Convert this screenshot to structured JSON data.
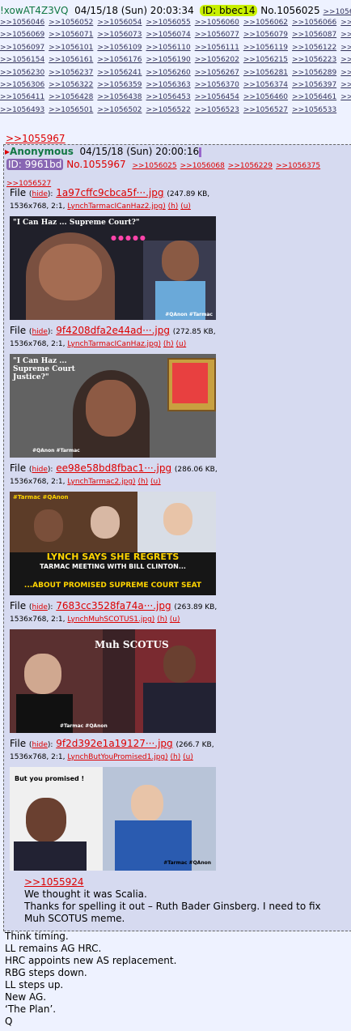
{
  "top_post": {
    "trip": "!xowAT4Z3VQ",
    "date": "04/15/18 (Sun) 20:03:34",
    "id": "ID: bbec14",
    "no": "No.1056025",
    "ref_partial": ">>105604"
  },
  "backlinks": [
    [
      ">>1056046",
      ">>1056052",
      ">>1056054",
      ">>1056055",
      ">>1056060",
      ">>1056062",
      ">>1056066",
      ">>10"
    ],
    [
      ">>1056069",
      ">>1056071",
      ">>1056073",
      ">>1056074",
      ">>1056077",
      ">>1056079",
      ">>1056087",
      ">>10"
    ],
    [
      ">>1056097",
      ">>1056101",
      ">>1056109",
      ">>1056110",
      ">>1056111",
      ">>1056119",
      ">>1056122",
      ">>10"
    ],
    [
      ">>1056154",
      ">>1056161",
      ">>1056176",
      ">>1056190",
      ">>1056202",
      ">>1056215",
      ">>1056223",
      ">>10"
    ],
    [
      ">>1056230",
      ">>1056237",
      ">>1056241",
      ">>1056260",
      ">>1056267",
      ">>1056281",
      ">>1056289",
      ">>10"
    ],
    [
      ">>1056306",
      ">>1056322",
      ">>1056359",
      ">>1056363",
      ">>1056370",
      ">>1056374",
      ">>1056397",
      ">>10"
    ],
    [
      ">>1056411",
      ">>1056428",
      ">>1056438",
      ">>1056453",
      ">>1056454",
      ">>1056460",
      ">>1056461",
      ">>10"
    ],
    [
      ">>1056493",
      ">>1056501",
      ">>1056502",
      ">>1056522",
      ">>1056523",
      ">>1056527",
      ">>1056533",
      ""
    ]
  ],
  "quoted_link": ">>1055967",
  "inner": {
    "name": "Anonymous",
    "date": "04/15/18 (Sun) 20:00:16",
    "id": "ID: 9961bd",
    "no": "No.1055967",
    "replies": [
      ">>1056025",
      ">>1056068",
      ">>1056229",
      ">>1056375",
      ">>1056527"
    ]
  },
  "file_label": "File",
  "hide_label": "hide",
  "h_label": "(h)",
  "u_label": "(u)",
  "files": [
    {
      "name": "1a97cffc9cbca5f···.jpg",
      "size": "(247.89 KB,",
      "dims": "1536x768, 2:1,",
      "orig": "LynchTarmacICanHaz2.jpg)"
    },
    {
      "name": "9f4208dfa2e44ad···.jpg",
      "size": "(272.85 KB,",
      "dims": "1536x768, 2:1,",
      "orig": "LynchTarmacICanHaz.jpg)"
    },
    {
      "name": "ee98e58bd8fbac1···.jpg",
      "size": "(286.06 KB,",
      "dims": "1536x768, 2:1,",
      "orig": "LynchTarmac2.jpg)"
    },
    {
      "name": "7683cc3528fa74a···.jpg",
      "size": "(263.89 KB,",
      "dims": "1536x768, 2:1,",
      "orig": "LynchMuhSCOTUS1.jpg)"
    },
    {
      "name": "9f2d392e1a19127···.jpg",
      "size": "(266.7 KB,",
      "dims": "1536x768, 2:1,",
      "orig": "LynchButYouPromised1.jpg)"
    }
  ],
  "image_text": {
    "i1": "\"I Can Haz ... Supreme Court?\"",
    "i1tag": "#QAnon #Tarmac",
    "i2": "\"I Can Haz ... Supreme Court Justice?\"",
    "i2tag": "#QAnon #Tarmac",
    "i3top": "#Tarmac #QAnon",
    "i3a": "LYNCH SAYS SHE REGRETS",
    "i3b": "TARMAC MEETING WITH BILL CLINTON...",
    "i3c": "...ABOUT PROMISED SUPREME COURT SEAT",
    "i4": "Muh SCOTUS",
    "i4tag": "#Tarmac #QAnon",
    "i5": "But you promised !",
    "i5tag": "#Tarmac #QAnon"
  },
  "quote": {
    "ref": ">>1055924",
    "lines": [
      "We thought it was Scalia.",
      "Thanks for spelling it out – Ruth Bader Ginsberg.  I need to fix",
      "Muh SCOTUS meme."
    ]
  },
  "body_lines": [
    "Think timing.",
    "LL remains AG HRC.",
    "HRC appoints new AS replacement.",
    "RBG steps down.",
    "LL steps up.",
    "New AG.",
    "‘The Plan’.",
    "Q"
  ],
  "colors": {
    "bg": "#eef2ff",
    "reply_bg": "#d6daf0",
    "name": "#117743",
    "link": "#d00000",
    "id_top": "#c8f000",
    "id_inner": "#8866b3"
  }
}
